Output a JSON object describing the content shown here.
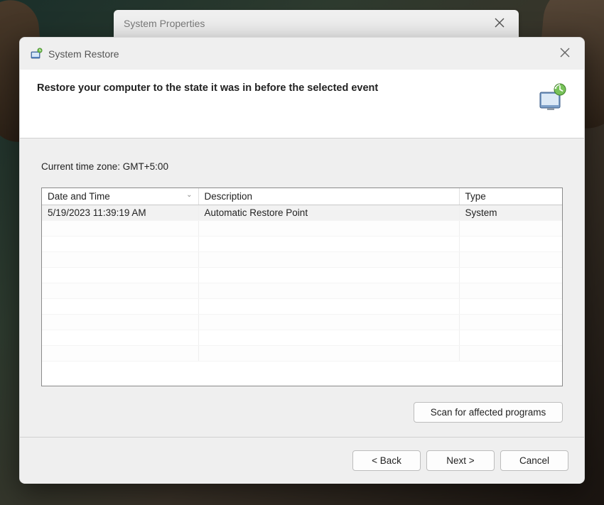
{
  "parentWindow": {
    "title": "System Properties"
  },
  "dialog": {
    "title": "System Restore",
    "heading": "Restore your computer to the state it was in before the selected event"
  },
  "timezone": {
    "label": "Current time zone: GMT+5:00"
  },
  "table": {
    "columns": {
      "date": "Date and Time",
      "description": "Description",
      "type": "Type"
    },
    "rows": [
      {
        "date": "5/19/2023 11:39:19 AM",
        "description": "Automatic Restore Point",
        "type": "System"
      }
    ]
  },
  "buttons": {
    "scan": "Scan for affected programs",
    "back": "< Back",
    "next": "Next >",
    "cancel": "Cancel"
  }
}
